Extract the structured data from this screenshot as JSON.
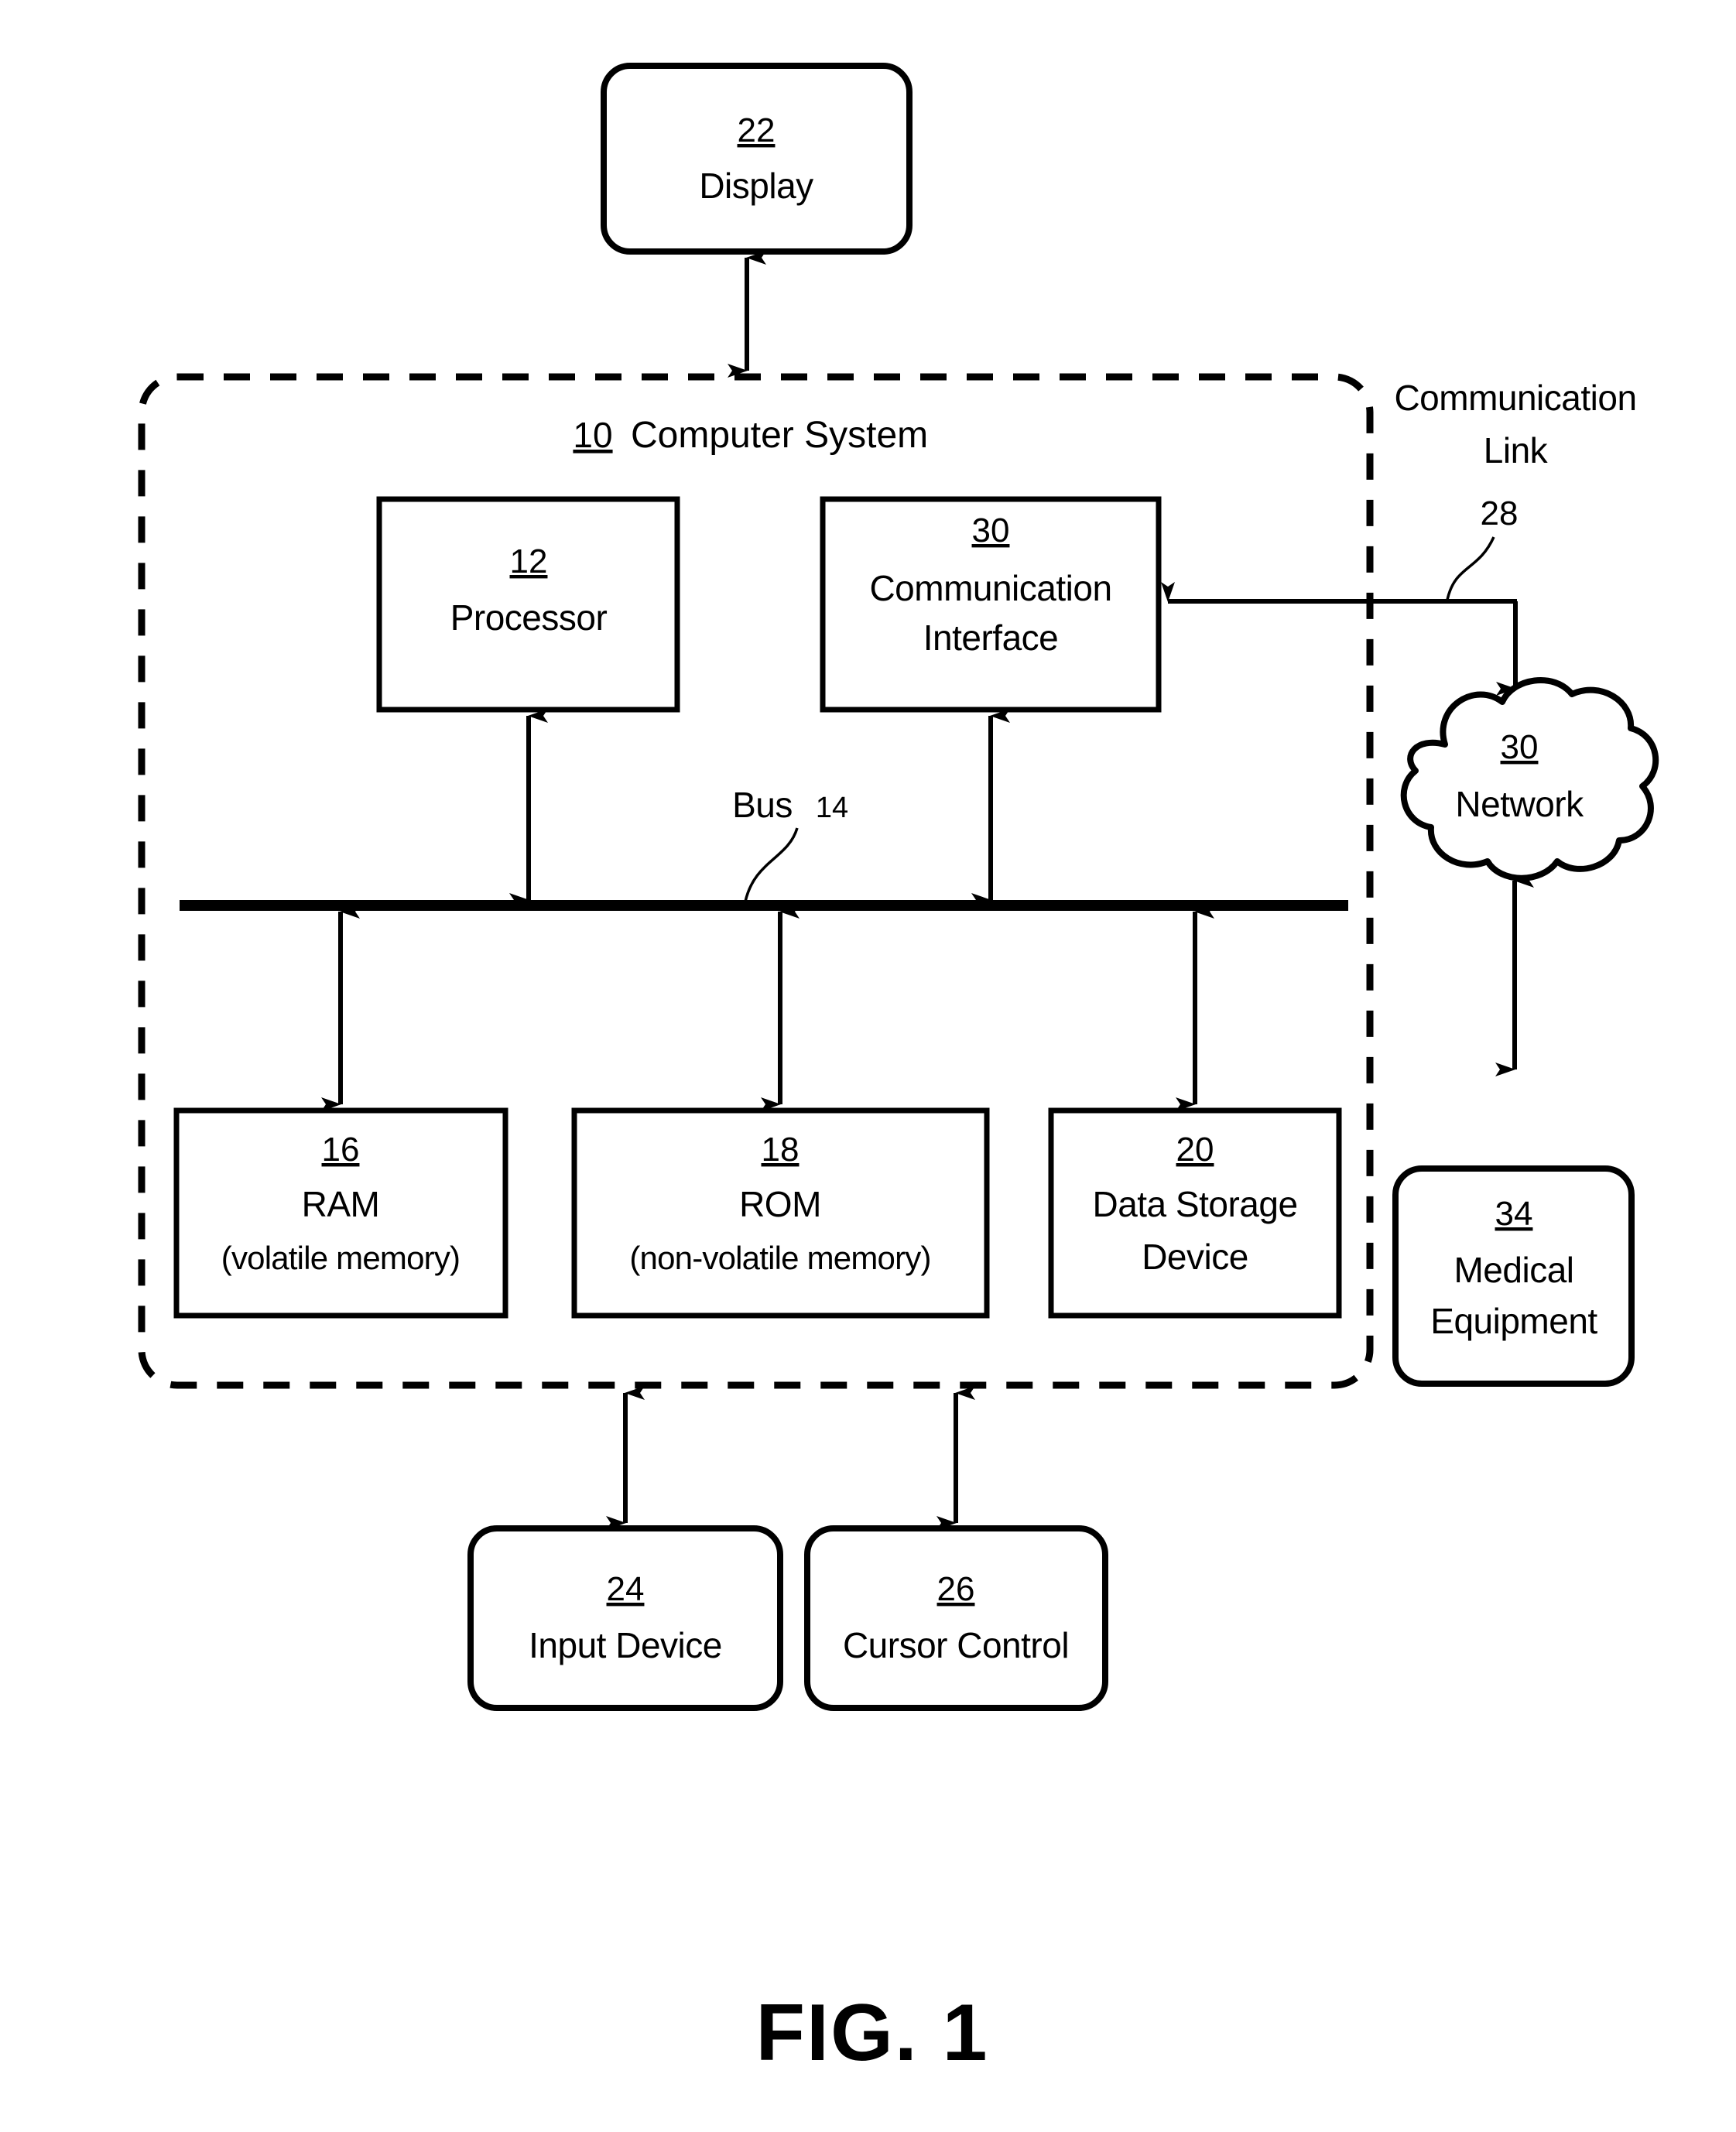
{
  "figure": {
    "caption": "FIG. 1",
    "system": {
      "ref": "10",
      "label": "Computer System"
    },
    "bus": {
      "label": "Bus",
      "ref": "14"
    },
    "communication_link": {
      "line1": "Communication",
      "line2": "Link",
      "ref": "28"
    },
    "blocks": [
      {
        "id": "display",
        "ref": "22",
        "label": "Display",
        "shape": "rounded-rect"
      },
      {
        "id": "processor",
        "ref": "12",
        "label": "Processor",
        "shape": "rect"
      },
      {
        "id": "communication-interface",
        "ref": "30",
        "label_line1": "Communication",
        "label_line2": "Interface",
        "shape": "rect"
      },
      {
        "id": "ram",
        "ref": "16",
        "label_line1": "RAM",
        "label_line2": "(volatile memory)",
        "shape": "rect"
      },
      {
        "id": "rom",
        "ref": "18",
        "label_line1": "ROM",
        "label_line2": "(non-volatile memory)",
        "shape": "rect"
      },
      {
        "id": "data-storage-device",
        "ref": "20",
        "label_line1": "Data Storage",
        "label_line2": "Device",
        "shape": "rect"
      },
      {
        "id": "input-device",
        "ref": "24",
        "label": "Input Device",
        "shape": "rounded-rect"
      },
      {
        "id": "cursor-control",
        "ref": "26",
        "label": "Cursor Control",
        "shape": "rounded-rect"
      },
      {
        "id": "network",
        "ref": "30",
        "label": "Network",
        "shape": "cloud"
      },
      {
        "id": "medical-equipment",
        "ref": "34",
        "label_line1": "Medical",
        "label_line2": "Equipment",
        "shape": "rounded-rect"
      }
    ],
    "colors": {
      "ink": "#000000",
      "paper": "#ffffff"
    }
  }
}
